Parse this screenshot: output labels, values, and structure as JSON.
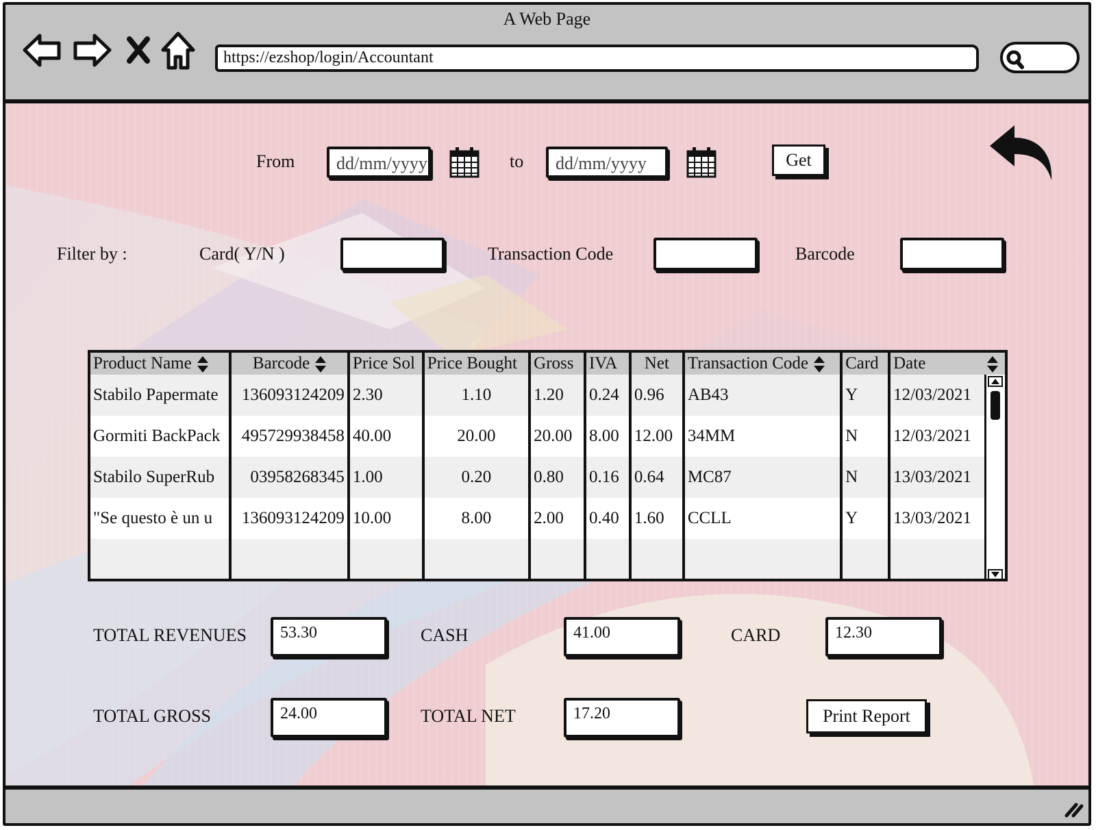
{
  "window": {
    "title": "A Web Page"
  },
  "address_bar": {
    "url": "https://ezshop/login/Accountant"
  },
  "icons": {
    "back": "back-arrow-icon",
    "forward": "forward-arrow-icon",
    "stop": "close-icon",
    "home": "home-icon",
    "search": "search-icon",
    "calendar": "calendar-icon",
    "undo": "undo-arrow-icon"
  },
  "date_range": {
    "from_label": "From",
    "from_value": "dd/mm/yyyy",
    "to_label": "to",
    "to_value": "dd/mm/yyyy",
    "get_button": "Get"
  },
  "filters": {
    "filter_by_label": "Filter by :",
    "card_label": "Card( Y/N )",
    "card_value": "",
    "transaction_code_label": "Transaction Code",
    "transaction_code_value": "",
    "barcode_label": "Barcode",
    "barcode_value": ""
  },
  "table": {
    "columns": [
      "Product Name",
      "Barcode",
      "Price Sol",
      "Price Bought",
      "Gross",
      "IVA",
      "Net",
      "Transaction Code",
      "Card",
      "Date"
    ],
    "rows": [
      [
        "Stabilo Papermate",
        "136093124209",
        "2.30",
        "1.10",
        "1.20",
        "0.24",
        "0.96",
        "AB43",
        "Y",
        "12/03/2021"
      ],
      [
        "Gormiti BackPack",
        "495729938458",
        "40.00",
        "20.00",
        "20.00",
        "8.00",
        "12.00",
        "34MM",
        "N",
        "12/03/2021"
      ],
      [
        "Stabilo SuperRub",
        "03958268345",
        "1.00",
        "0.20",
        "0.80",
        "0.16",
        "0.64",
        "MC87",
        "N",
        "13/03/2021"
      ],
      [
        "\"Se questo è un u",
        "136093124209",
        "10.00",
        "8.00",
        "2.00",
        "0.40",
        "1.60",
        "CCLL",
        "Y",
        "13/03/2021"
      ],
      [
        "",
        "",
        "",
        "",
        "",
        "",
        "",
        "",
        "",
        ""
      ]
    ]
  },
  "totals": {
    "total_revenues_label": "TOTAL REVENUES",
    "total_revenues_value": "53.30",
    "cash_label": "CASH",
    "cash_value": "41.00",
    "card_label": "CARD",
    "card_value": "12.30",
    "total_gross_label": "TOTAL GROSS",
    "total_gross_value": "24.00",
    "total_net_label": "TOTAL NET",
    "total_net_value": "17.20",
    "print_button": "Print  Report"
  }
}
